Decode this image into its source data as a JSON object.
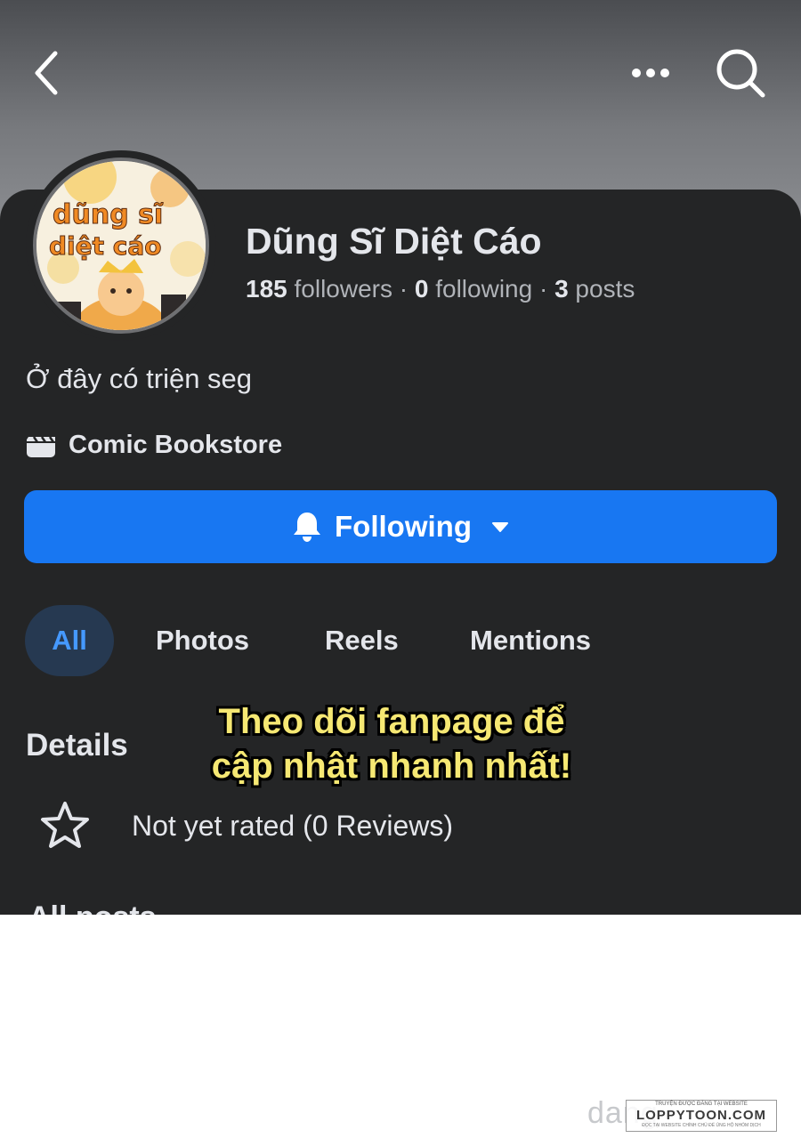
{
  "header": {
    "back_icon": "chevron-left-icon",
    "more_icon": "ellipsis-icon",
    "search_icon": "search-icon"
  },
  "profile": {
    "name": "Dũng Sĩ Diệt Cáo",
    "followers_count": "185",
    "followers_label": " followers",
    "following_count": "0",
    "following_label": " following",
    "posts_count": "3",
    "posts_label": " posts",
    "separator": " · ",
    "avatar_text_line1": "dũng sĩ",
    "avatar_text_line2": "diệt cáo",
    "bio": "Ở đây có triện seg",
    "category": "Comic Bookstore",
    "category_icon": "clapperboard-icon"
  },
  "follow_button": {
    "label": "Following",
    "icon": "bell-icon",
    "caret_icon": "caret-down-icon",
    "color": "#1877f2"
  },
  "tabs": [
    {
      "label": "All",
      "active": true
    },
    {
      "label": "Photos",
      "active": false
    },
    {
      "label": "Reels",
      "active": false
    },
    {
      "label": "Mentions",
      "active": false
    }
  ],
  "details": {
    "title": "Details",
    "rating_icon": "star-outline-icon",
    "rating_text": "Not yet rated (0 Reviews)"
  },
  "next_section_partial": "All posts",
  "overlay_caption": {
    "line1": "Theo dõi fanpage để",
    "line2": "cập nhật nhanh nhất!"
  },
  "watermark": {
    "site_text": "dang",
    "box_top": "TRUYỆN ĐƯỢC ĐĂNG TẠI WEBSITE",
    "box_main": "LOPPYTOON.COM",
    "box_bottom": "ĐỌC TẠI WEBSITE CHÍNH CHỦ ĐỂ ỦNG HỘ NHÓM DỊCH"
  }
}
